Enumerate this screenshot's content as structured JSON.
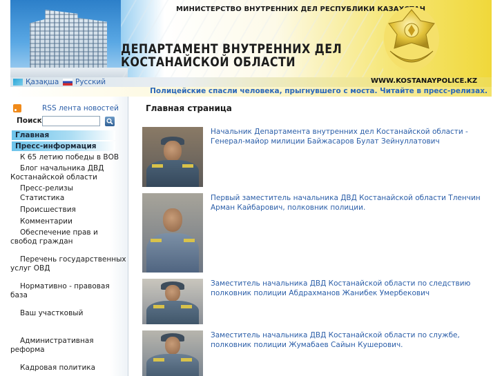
{
  "header": {
    "ministry": "МИНИСТЕРСТВО ВНУТРЕННИХ ДЕЛ РЕСПУБЛИКИ КАЗАХСТАН",
    "title_line1": "ДЕПАРТАМЕНТ ВНУТРЕННИХ ДЕЛ",
    "title_line2": "КОСТАНАЙСКОЙ ОБЛАСТИ",
    "url": "WWW.KOSTANAYPOLICE.KZ"
  },
  "languages": [
    {
      "label": "Қазақша",
      "flag": "kz-flag-icon"
    },
    {
      "label": "Русский",
      "flag": "ru-flag-icon"
    }
  ],
  "ticker": "Полицейские спасли человека, прыгнувшего с моста. Читайте в пресс-релизах.",
  "sidebar": {
    "rss_label": "RSS лента новостей",
    "search_label": "Поиск",
    "search_value": "",
    "categories": [
      "Главная",
      "Пресс-информация"
    ],
    "items": [
      "К 65 летию победы в ВОВ",
      "Блог начальника ДВД Костанайской области",
      "Пресс-релизы",
      "Статистика",
      "Происшествия",
      "Комментарии",
      "Обеспечение прав и свобод граждан",
      "Перечень государственных услуг ОВД",
      "Нормативно - правовая база",
      "Ваш участковый",
      "Административная реформа",
      "Кадровая политика"
    ]
  },
  "main": {
    "title": "Главная страница",
    "news": [
      {
        "text": "Начальник Департамента внутренних дел Костанайской области - Генерал-майор милиции Байжасаров Булат Зейнуллатович"
      },
      {
        "text": "Первый заместитель начальника ДВД Костанайской области Тленчин Арман Кайбарович, полковник полиции."
      },
      {
        "text": "Заместитель начальника ДВД Костанайской области по следствию полковник полиции Абдрахманов Жанибек Умербекович"
      },
      {
        "text": "Заместитель начальника ДВД Костанайской области по службе, полковник полиции Жумабаев Сайын Кушерович."
      }
    ]
  },
  "colors": {
    "link": "#2b5ea8",
    "ticker": "#2a67b8",
    "category_bg": "#6cc3ea",
    "banner_gold": "#f0d83a"
  }
}
